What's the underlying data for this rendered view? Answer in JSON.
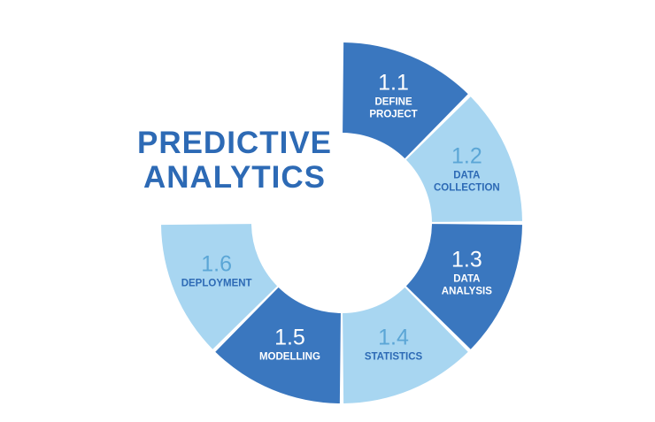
{
  "title": {
    "line1": "PREDICTIVE",
    "line2": "ANALYTICS"
  },
  "colors": {
    "dark": "#3a77bf",
    "light": "#a8d6f1",
    "dark_text": "#ffffff",
    "light_num": "#5ba6d6",
    "light_lbl": "#2d6ab5",
    "title": "#2d6ab5"
  },
  "segments": [
    {
      "number": "1.1",
      "label": [
        "DEFINE",
        "PROJECT"
      ],
      "tone": "dark"
    },
    {
      "number": "1.2",
      "label": [
        "DATA",
        "COLLECTION"
      ],
      "tone": "light"
    },
    {
      "number": "1.3",
      "label": [
        "DATA",
        "ANALYSIS"
      ],
      "tone": "dark"
    },
    {
      "number": "1.4",
      "label": [
        "STATISTICS"
      ],
      "tone": "light"
    },
    {
      "number": "1.5",
      "label": [
        "MODELLING"
      ],
      "tone": "dark"
    },
    {
      "number": "1.6",
      "label": [
        "DEPLOYMENT"
      ],
      "tone": "light"
    }
  ]
}
